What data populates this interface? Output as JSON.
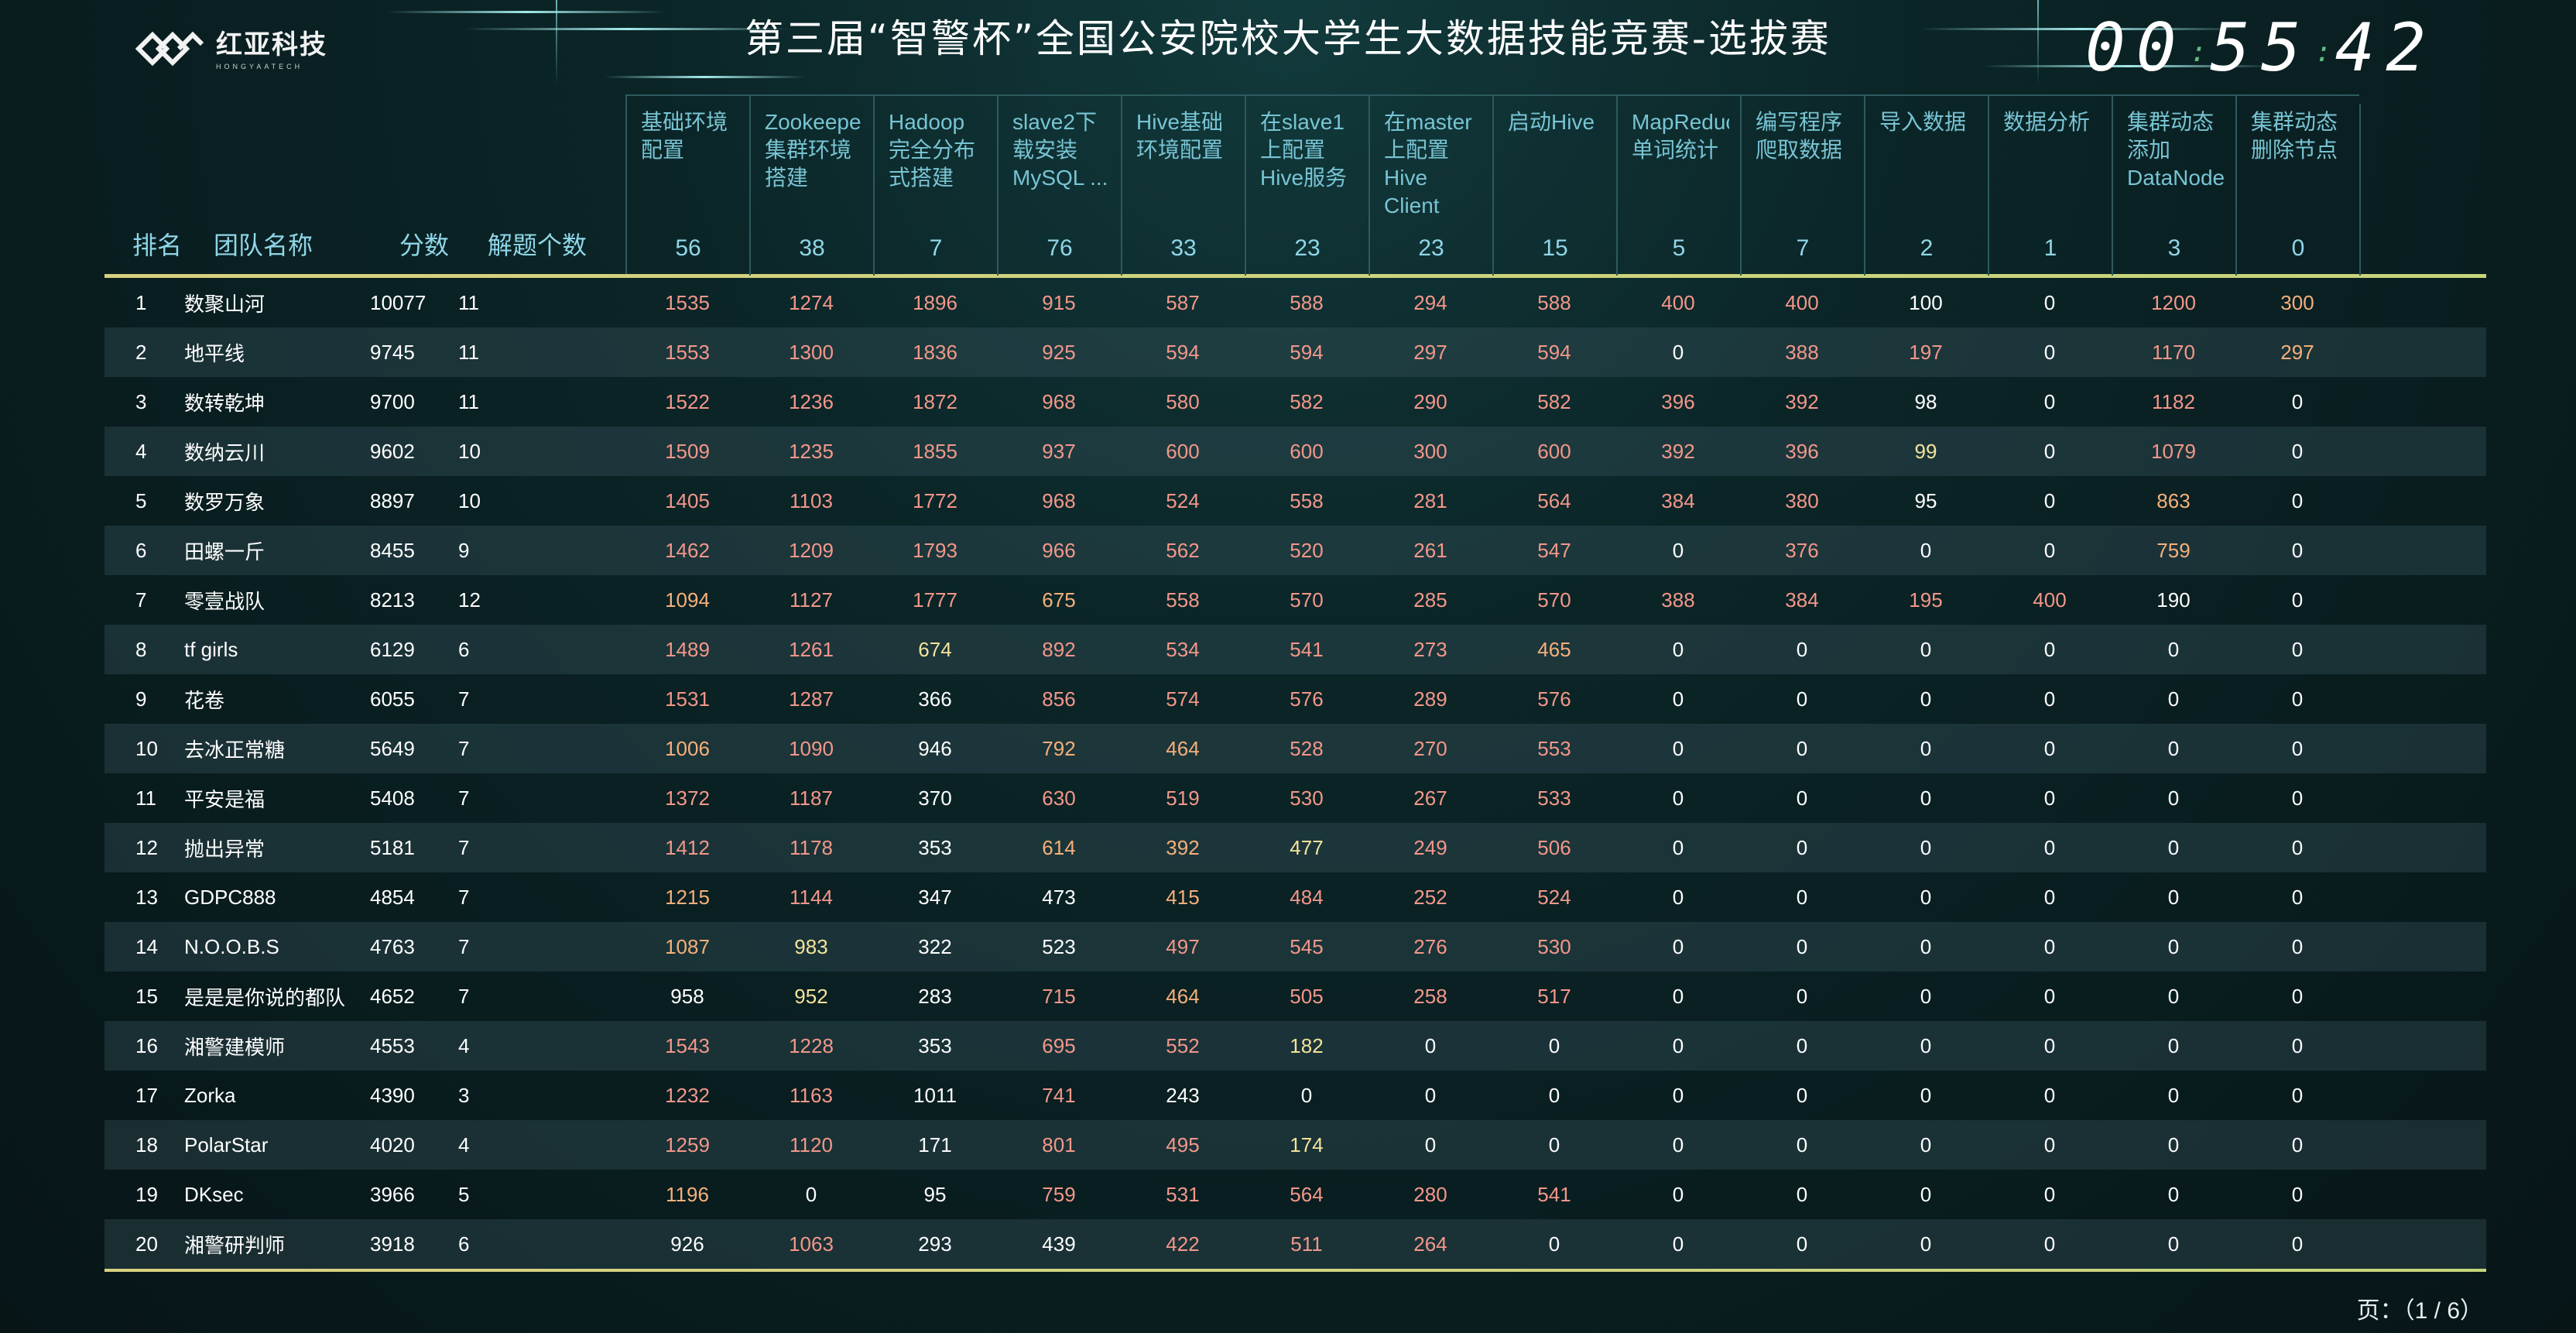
{
  "header": {
    "logo_cn": "红亚科技",
    "logo_en": "HONGYAATECH",
    "title": "第三届“智警杯”全国公安院校大学生大数据技能竞赛-选拔赛",
    "timer": {
      "h": "00",
      "m": "55",
      "s": "42"
    }
  },
  "columns": {
    "rank": "排名",
    "team": "团队名称",
    "score": "分数",
    "solved": "解题个数"
  },
  "problems": [
    {
      "name": "基础环境配置",
      "count": "56"
    },
    {
      "name": "Zookeeper集群环境搭建",
      "count": "38"
    },
    {
      "name": "Hadoop完全分布式搭建",
      "count": "7"
    },
    {
      "name": "slave2下载安装MySQL ...",
      "count": "76"
    },
    {
      "name": "Hive基础环境配置",
      "count": "33"
    },
    {
      "name": "在slave1上配置Hive服务",
      "count": "23"
    },
    {
      "name": "在master上配置Hive Client",
      "count": "23"
    },
    {
      "name": "启动Hive",
      "count": "15"
    },
    {
      "name": "MapReduce单词统计",
      "count": "5"
    },
    {
      "name": "编写程序爬取数据",
      "count": "7"
    },
    {
      "name": "导入数据",
      "count": "2"
    },
    {
      "name": "数据分析",
      "count": "1"
    },
    {
      "name": "集群动态添加DataNode…",
      "count": "3"
    },
    {
      "name": "集群动态删除节点",
      "count": "0"
    }
  ],
  "rows": [
    {
      "rank": "1",
      "team": "数聚山河",
      "score": "10077",
      "solved": "11",
      "vals": [
        "1535",
        "1274",
        "1896",
        "915",
        "587",
        "588",
        "294",
        "588",
        "400",
        "400",
        "100",
        "0",
        "1200",
        "300"
      ],
      "colors": [
        "r",
        "r",
        "r",
        "r",
        "r",
        "r",
        "r",
        "r",
        "r",
        "r",
        "w",
        "w",
        "r",
        "o"
      ]
    },
    {
      "rank": "2",
      "team": "地平线",
      "score": "9745",
      "solved": "11",
      "vals": [
        "1553",
        "1300",
        "1836",
        "925",
        "594",
        "594",
        "297",
        "594",
        "0",
        "388",
        "197",
        "0",
        "1170",
        "297"
      ],
      "colors": [
        "r",
        "r",
        "r",
        "r",
        "r",
        "r",
        "r",
        "r",
        "w",
        "r",
        "r",
        "w",
        "r",
        "o"
      ]
    },
    {
      "rank": "3",
      "team": "数转乾坤",
      "score": "9700",
      "solved": "11",
      "vals": [
        "1522",
        "1236",
        "1872",
        "968",
        "580",
        "582",
        "290",
        "582",
        "396",
        "392",
        "98",
        "0",
        "1182",
        "0"
      ],
      "colors": [
        "r",
        "r",
        "r",
        "r",
        "r",
        "r",
        "r",
        "r",
        "r",
        "r",
        "w",
        "w",
        "r",
        "w"
      ]
    },
    {
      "rank": "4",
      "team": "数纳云川",
      "score": "9602",
      "solved": "10",
      "vals": [
        "1509",
        "1235",
        "1855",
        "937",
        "600",
        "600",
        "300",
        "600",
        "392",
        "396",
        "99",
        "0",
        "1079",
        "0"
      ],
      "colors": [
        "r",
        "r",
        "r",
        "r",
        "r",
        "r",
        "r",
        "r",
        "r",
        "r",
        "y",
        "w",
        "r",
        "w"
      ]
    },
    {
      "rank": "5",
      "team": "数罗万象",
      "score": "8897",
      "solved": "10",
      "vals": [
        "1405",
        "1103",
        "1772",
        "968",
        "524",
        "558",
        "281",
        "564",
        "384",
        "380",
        "95",
        "0",
        "863",
        "0"
      ],
      "colors": [
        "r",
        "r",
        "r",
        "r",
        "r",
        "r",
        "r",
        "r",
        "r",
        "r",
        "w",
        "w",
        "o",
        "w"
      ]
    },
    {
      "rank": "6",
      "team": "田螺一斤",
      "score": "8455",
      "solved": "9",
      "vals": [
        "1462",
        "1209",
        "1793",
        "966",
        "562",
        "520",
        "261",
        "547",
        "0",
        "376",
        "0",
        "0",
        "759",
        "0"
      ],
      "colors": [
        "r",
        "r",
        "r",
        "r",
        "r",
        "r",
        "r",
        "r",
        "w",
        "r",
        "w",
        "w",
        "o",
        "w"
      ]
    },
    {
      "rank": "7",
      "team": "零壹战队",
      "score": "8213",
      "solved": "12",
      "vals": [
        "1094",
        "1127",
        "1777",
        "675",
        "558",
        "570",
        "285",
        "570",
        "388",
        "384",
        "195",
        "400",
        "190",
        "0"
      ],
      "colors": [
        "o",
        "r",
        "r",
        "o",
        "r",
        "r",
        "r",
        "r",
        "r",
        "r",
        "r",
        "r",
        "w",
        "w"
      ]
    },
    {
      "rank": "8",
      "team": "tf girls",
      "score": "6129",
      "solved": "6",
      "vals": [
        "1489",
        "1261",
        "674",
        "892",
        "534",
        "541",
        "273",
        "465",
        "0",
        "0",
        "0",
        "0",
        "0",
        "0"
      ],
      "colors": [
        "r",
        "r",
        "y",
        "r",
        "r",
        "r",
        "r",
        "o",
        "w",
        "w",
        "w",
        "w",
        "w",
        "w"
      ]
    },
    {
      "rank": "9",
      "team": "花卷",
      "score": "6055",
      "solved": "7",
      "vals": [
        "1531",
        "1287",
        "366",
        "856",
        "574",
        "576",
        "289",
        "576",
        "0",
        "0",
        "0",
        "0",
        "0",
        "0"
      ],
      "colors": [
        "r",
        "r",
        "w",
        "r",
        "r",
        "r",
        "r",
        "r",
        "w",
        "w",
        "w",
        "w",
        "w",
        "w"
      ]
    },
    {
      "rank": "10",
      "team": "去冰正常糖",
      "score": "5649",
      "solved": "7",
      "vals": [
        "1006",
        "1090",
        "946",
        "792",
        "464",
        "528",
        "270",
        "553",
        "0",
        "0",
        "0",
        "0",
        "0",
        "0"
      ],
      "colors": [
        "o",
        "r",
        "w",
        "o",
        "o",
        "r",
        "r",
        "r",
        "w",
        "w",
        "w",
        "w",
        "w",
        "w"
      ]
    },
    {
      "rank": "11",
      "team": "平安是福",
      "score": "5408",
      "solved": "7",
      "vals": [
        "1372",
        "1187",
        "370",
        "630",
        "519",
        "530",
        "267",
        "533",
        "0",
        "0",
        "0",
        "0",
        "0",
        "0"
      ],
      "colors": [
        "r",
        "r",
        "w",
        "r",
        "r",
        "r",
        "r",
        "r",
        "w",
        "w",
        "w",
        "w",
        "w",
        "w"
      ]
    },
    {
      "rank": "12",
      "team": "抛出异常",
      "score": "5181",
      "solved": "7",
      "vals": [
        "1412",
        "1178",
        "353",
        "614",
        "392",
        "477",
        "249",
        "506",
        "0",
        "0",
        "0",
        "0",
        "0",
        "0"
      ],
      "colors": [
        "r",
        "r",
        "w",
        "o",
        "o",
        "y",
        "r",
        "r",
        "w",
        "w",
        "w",
        "w",
        "w",
        "w"
      ]
    },
    {
      "rank": "13",
      "team": "GDPC888",
      "score": "4854",
      "solved": "7",
      "vals": [
        "1215",
        "1144",
        "347",
        "473",
        "415",
        "484",
        "252",
        "524",
        "0",
        "0",
        "0",
        "0",
        "0",
        "0"
      ],
      "colors": [
        "o",
        "r",
        "w",
        "w",
        "o",
        "r",
        "r",
        "r",
        "w",
        "w",
        "w",
        "w",
        "w",
        "w"
      ]
    },
    {
      "rank": "14",
      "team": "N.O.O.B.S",
      "score": "4763",
      "solved": "7",
      "vals": [
        "1087",
        "983",
        "322",
        "523",
        "497",
        "545",
        "276",
        "530",
        "0",
        "0",
        "0",
        "0",
        "0",
        "0"
      ],
      "colors": [
        "o",
        "y",
        "w",
        "w",
        "r",
        "r",
        "r",
        "r",
        "w",
        "w",
        "w",
        "w",
        "w",
        "w"
      ]
    },
    {
      "rank": "15",
      "team": "是是是你说的都队",
      "score": "4652",
      "solved": "7",
      "vals": [
        "958",
        "952",
        "283",
        "715",
        "464",
        "505",
        "258",
        "517",
        "0",
        "0",
        "0",
        "0",
        "0",
        "0"
      ],
      "colors": [
        "w",
        "y",
        "w",
        "r",
        "o",
        "r",
        "r",
        "r",
        "w",
        "w",
        "w",
        "w",
        "w",
        "w"
      ]
    },
    {
      "rank": "16",
      "team": "湘警建模师",
      "score": "4553",
      "solved": "4",
      "vals": [
        "1543",
        "1228",
        "353",
        "695",
        "552",
        "182",
        "0",
        "0",
        "0",
        "0",
        "0",
        "0",
        "0",
        "0"
      ],
      "colors": [
        "r",
        "r",
        "w",
        "r",
        "r",
        "y",
        "w",
        "w",
        "w",
        "w",
        "w",
        "w",
        "w",
        "w"
      ]
    },
    {
      "rank": "17",
      "team": "Zorka",
      "score": "4390",
      "solved": "3",
      "vals": [
        "1232",
        "1163",
        "1011",
        "741",
        "243",
        "0",
        "0",
        "0",
        "0",
        "0",
        "0",
        "0",
        "0",
        "0"
      ],
      "colors": [
        "r",
        "r",
        "w",
        "r",
        "w",
        "w",
        "w",
        "w",
        "w",
        "w",
        "w",
        "w",
        "w",
        "w"
      ]
    },
    {
      "rank": "18",
      "team": "PolarStar",
      "score": "4020",
      "solved": "4",
      "vals": [
        "1259",
        "1120",
        "171",
        "801",
        "495",
        "174",
        "0",
        "0",
        "0",
        "0",
        "0",
        "0",
        "0",
        "0"
      ],
      "colors": [
        "r",
        "r",
        "w",
        "r",
        "r",
        "y",
        "w",
        "w",
        "w",
        "w",
        "w",
        "w",
        "w",
        "w"
      ]
    },
    {
      "rank": "19",
      "team": "DKsec",
      "score": "3966",
      "solved": "5",
      "vals": [
        "1196",
        "0",
        "95",
        "759",
        "531",
        "564",
        "280",
        "541",
        "0",
        "0",
        "0",
        "0",
        "0",
        "0"
      ],
      "colors": [
        "o",
        "w",
        "w",
        "r",
        "r",
        "r",
        "r",
        "r",
        "w",
        "w",
        "w",
        "w",
        "w",
        "w"
      ]
    },
    {
      "rank": "20",
      "team": "湘警研判师",
      "score": "3918",
      "solved": "6",
      "vals": [
        "926",
        "1063",
        "293",
        "439",
        "422",
        "511",
        "264",
        "0",
        "0",
        "0",
        "0",
        "0",
        "0",
        "0"
      ],
      "colors": [
        "w",
        "r",
        "w",
        "w",
        "r",
        "r",
        "r",
        "w",
        "w",
        "w",
        "w",
        "w",
        "w",
        "w"
      ]
    }
  ],
  "pager": "页：（1 / 6）"
}
